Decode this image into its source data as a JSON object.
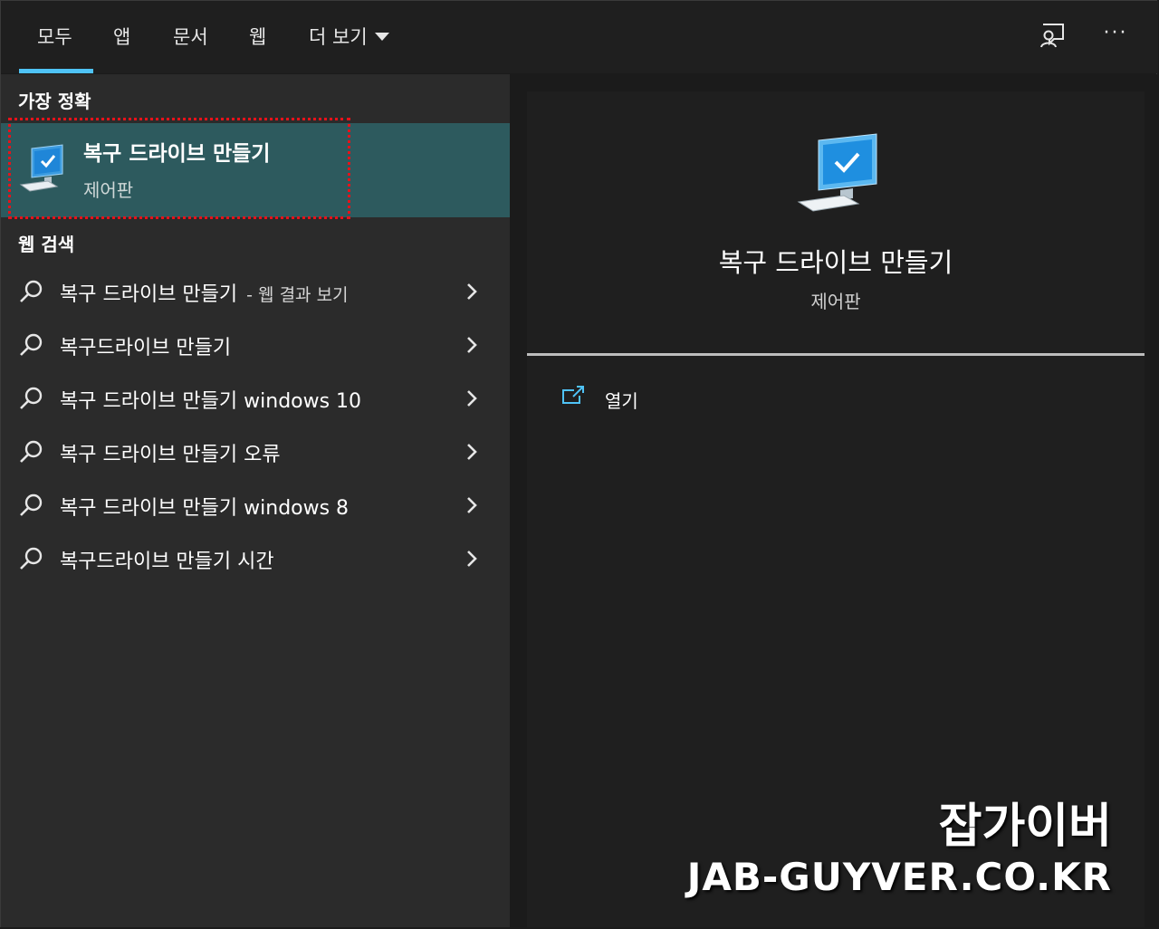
{
  "tabs": [
    {
      "label": "모두",
      "selected": true
    },
    {
      "label": "앱"
    },
    {
      "label": "문서"
    },
    {
      "label": "웹"
    },
    {
      "label": "더 보기"
    }
  ],
  "accent_color": "#4fc3f7",
  "icons": {
    "feedback": "feedback-icon",
    "more": "ellipsis-icon",
    "search": "search-icon",
    "chevron": "chevron-right-icon",
    "open": "open-external-icon",
    "app": "computer-check-icon"
  },
  "more_glyph": "···",
  "best_match": {
    "section_label": "가장 정확",
    "title": "복구 드라이브 만들기",
    "subtitle": "제어판"
  },
  "web_search": {
    "section_label": "웹 검색",
    "items": [
      {
        "text": "복구 드라이브 만들기",
        "suffix": "- 웹 결과 보기"
      },
      {
        "text": "복구드라이브 만들기",
        "suffix": ""
      },
      {
        "text": "복구 드라이브 만들기 windows 10",
        "suffix": ""
      },
      {
        "text": "복구 드라이브 만들기 오류",
        "suffix": ""
      },
      {
        "text": "복구 드라이브 만들기 windows 8",
        "suffix": ""
      },
      {
        "text": "복구드라이브 만들기 시간",
        "suffix": ""
      }
    ]
  },
  "detail": {
    "title": "복구 드라이브 만들기",
    "subtitle": "제어판",
    "actions": [
      {
        "label": "열기"
      }
    ]
  },
  "watermark": {
    "name": "잡가이버",
    "url": "JAB-GUYVER.CO.KR"
  }
}
